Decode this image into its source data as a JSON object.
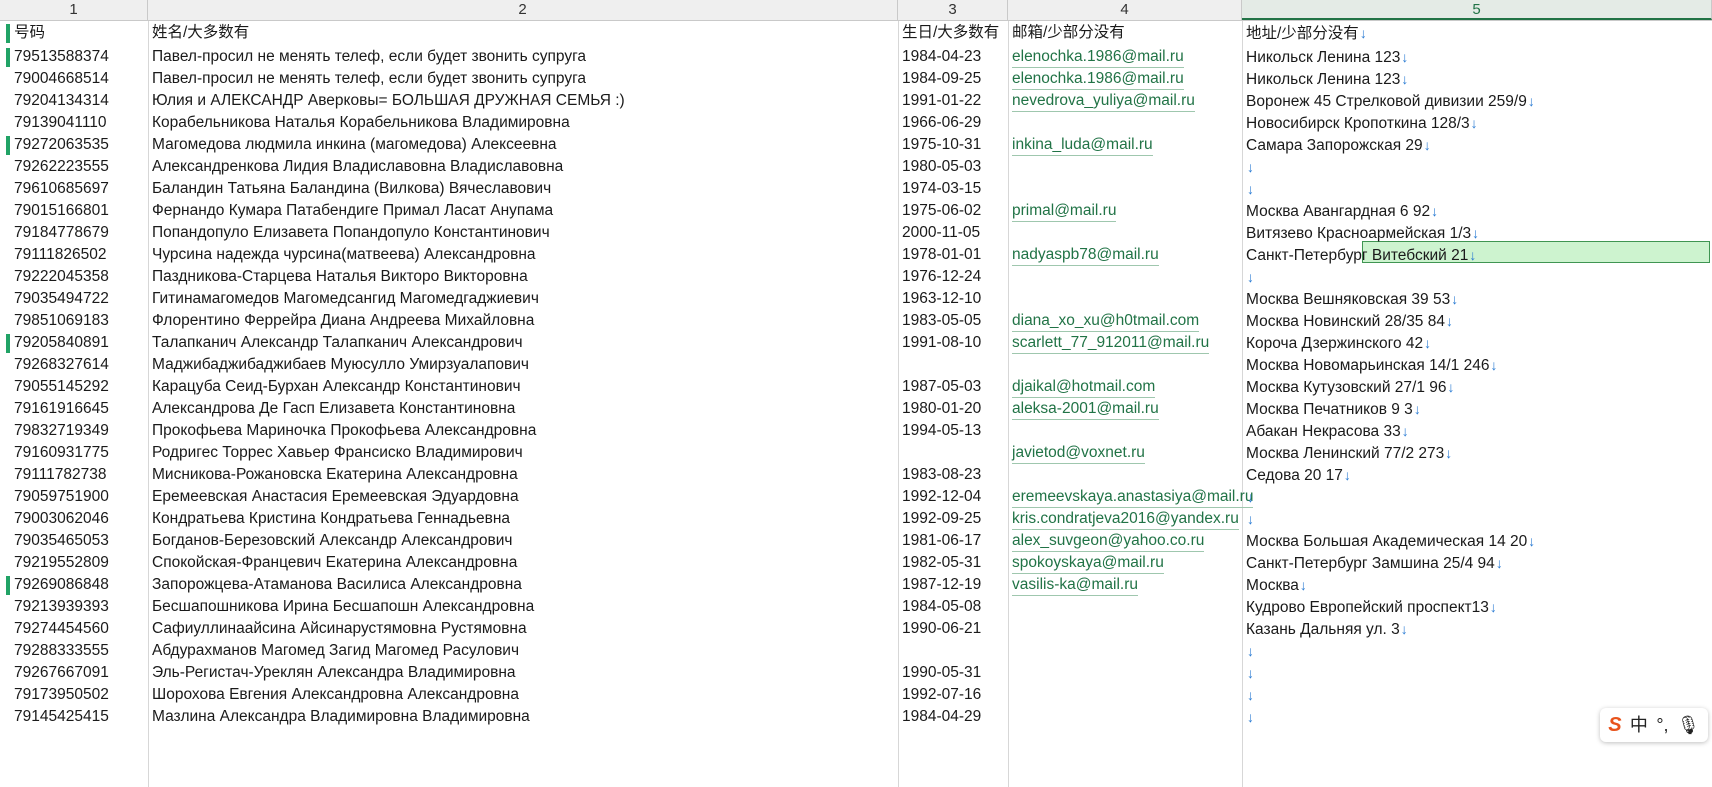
{
  "columns": [
    "1",
    "2",
    "3",
    "4",
    "5"
  ],
  "active_column": 4,
  "header_row": {
    "c1": "号码",
    "c2": "姓名/大多数有",
    "c3": "生日/大多数有",
    "c4": "邮箱/少部分没有",
    "c5": "地址/少部分没有"
  },
  "rows": [
    {
      "phone": "79513588374",
      "name": "Павел-просил не менять телеф, если будет звонить супруга",
      "birthday": "1984-04-23",
      "email": "elenochka.1986@mail.ru",
      "address": "Никольск Ленина 123"
    },
    {
      "phone": "79004668514",
      "name": "Павел-просил не менять телеф, если будет звонить супруга",
      "birthday": "1984-09-25",
      "email": "elenochka.1986@mail.ru",
      "address": "Никольск Ленина 123"
    },
    {
      "phone": "79204134314",
      "name": "Юлия и АЛЕКСАНДР Аверковы= БОЛЬШАЯ ДРУЖНАЯ СЕМЬЯ :)",
      "birthday": "1991-01-22",
      "email": "nevedrova_yuliya@mail.ru",
      "address": "Воронеж 45 Стрелковой дивизии 259/9"
    },
    {
      "phone": "79139041110",
      "name": "Корабельникова Наталья Корабельникова Владимировна",
      "birthday": "1966-06-29",
      "email": "",
      "address": "Новосибирск Кропоткина 128/3"
    },
    {
      "phone": "79272063535",
      "name": "Магомедова людмила инкина (магомедова) Алексеевна",
      "birthday": "1975-10-31",
      "email": "inkina_luda@mail.ru",
      "address": "Самара Запорожская 29"
    },
    {
      "phone": "79262223555",
      "name": "Александренкова Лидия Владиславовна Владиславовна",
      "birthday": "1980-05-03",
      "email": "",
      "address": ""
    },
    {
      "phone": "79610685697",
      "name": "Баландин Татьяна Баландина (Вилкова) Вячеславович",
      "birthday": "1974-03-15",
      "email": "",
      "address": ""
    },
    {
      "phone": "79015166801",
      "name": "Фернандо Кумара Патабендиге Примал Ласат Анупама",
      "birthday": "1975-06-02",
      "email": "primal@mail.ru",
      "address": "Москва Авангардная 6 92"
    },
    {
      "phone": "79184778679",
      "name": "Попандопуло Елизавета Попандопуло Константинович",
      "birthday": "2000-11-05",
      "email": "",
      "address": "Витязево Красноармейская 1/3"
    },
    {
      "phone": "79111826502",
      "name": "Чурсина надежда чурсина(матвеева) Александровна",
      "birthday": "1978-01-01",
      "email": "nadyaspb78@mail.ru",
      "address": "Санкт-Петербург Витебский 21"
    },
    {
      "phone": "79222045358",
      "name": "Паздникова-Старцева Наталья Викторо Викторовна",
      "birthday": "1976-12-24",
      "email": "",
      "address": ""
    },
    {
      "phone": "79035494722",
      "name": "Гитинамагомедов Магомедсангид Магомедгаджиевич",
      "birthday": "1963-12-10",
      "email": "",
      "address": "Москва Вешняковская 39 53"
    },
    {
      "phone": "79851069183",
      "name": "Флорентино Феррейра Диана Андреева Михайловна",
      "birthday": "1983-05-05",
      "email": "diana_xo_xu@h0tmail.com",
      "address": "Москва Новинский 28/35 84"
    },
    {
      "phone": "79205840891",
      "name": "Талапканич Александр Талапканич Александрович",
      "birthday": "1991-08-10",
      "email": "scarlett_77_912011@mail.ru",
      "address": "Короча Дзержинского 42"
    },
    {
      "phone": "79268327614",
      "name": "Маджибаджибаджибаев Муюсулло Умирзуалапович",
      "birthday": "",
      "email": "",
      "address": "Москва Новомарьинская 14/1 246"
    },
    {
      "phone": "79055145292",
      "name": "Карацуба Сеид-Бурхан Александр Константинович",
      "birthday": "1987-05-03",
      "email": "djaikal@hotmail.com",
      "address": "Москва Кутузовский 27/1 96"
    },
    {
      "phone": "79161916645",
      "name": "Александрова Де Гасп Елизавета Константиновна",
      "birthday": "1980-01-20",
      "email": "aleksa-2001@mail.ru",
      "address": "Москва Печатников 9 3"
    },
    {
      "phone": "79832719349",
      "name": "Прокофьева Мариночка Прокофьева Александровна",
      "birthday": "1994-05-13",
      "email": "",
      "address": "Абакан Некрасова 33"
    },
    {
      "phone": "79160931775",
      "name": "Родригес Торрес Хавьер Франсиско Владимирович",
      "birthday": "",
      "email": "javietod@voxnet.ru",
      "address": "Москва Ленинский 77/2 273"
    },
    {
      "phone": "79111782738",
      "name": "Мисникова-Рожановска Екатерина Александровна",
      "birthday": "1983-08-23",
      "email": "",
      "address": "Седова 20 17"
    },
    {
      "phone": "79059751900",
      "name": "Еремеевская Анастасия Еремеевская Эдуардовна",
      "birthday": "1992-12-04",
      "email": "eremeevskaya.anastasiya@mail.ru",
      "address": ""
    },
    {
      "phone": "79003062046",
      "name": "Кондратьева Кристина Кондратьева Геннадьевна",
      "birthday": "1992-09-25",
      "email": "kris.condratjeva2016@yandex.ru",
      "address": ""
    },
    {
      "phone": "79035465053",
      "name": "Богданов-Березовский Александр Александрович",
      "birthday": "1981-06-17",
      "email": "alex_suvgeon@yahoo.co.ru",
      "address": "Москва Большая Академическая 14 20"
    },
    {
      "phone": "79219552809",
      "name": "Спокойская-Францевич Екатерина Александровна",
      "birthday": "1982-05-31",
      "email": "spokoyskaya@mail.ru",
      "address": "Санкт-Петербург Замшина 25/4 94"
    },
    {
      "phone": "79269086848",
      "name": "Запорожцева-Атаманова Василиса Александровна",
      "birthday": "1987-12-19",
      "email": "vasilis-ka@mail.ru",
      "address": "Москва"
    },
    {
      "phone": "79213939393",
      "name": "Бесшапошникова Ирина Бесшапошн Александровна",
      "birthday": "1984-05-08",
      "email": "",
      "address": "Кудрово Европейский проспект13"
    },
    {
      "phone": "79274454560",
      "name": "Сафиуллинаайсина Айсинарустямовна Рустямовна",
      "birthday": "1990-06-21",
      "email": "",
      "address": "Казань Дальняя ул. 3"
    },
    {
      "phone": "79288333555",
      "name": "Абдурахманов Магомед Загид Магомед Расулович",
      "birthday": "",
      "email": "",
      "address": ""
    },
    {
      "phone": "79267667091",
      "name": "Эль-Регистач-Уреклян Александра Владимировна",
      "birthday": "1990-05-31",
      "email": "",
      "address": ""
    },
    {
      "phone": "79173950502",
      "name": "Шорохова Евгения Александровна Александровна",
      "birthday": "1992-07-16",
      "email": "",
      "address": ""
    },
    {
      "phone": "79145425415",
      "name": "Мазлина Александра Владимировна Владимировна",
      "birthday": "1984-04-29",
      "email": "",
      "address": ""
    }
  ],
  "marked_rows": [
    0,
    4,
    13,
    24
  ],
  "selected_row": 9,
  "eol_glyph": "↓",
  "ime": {
    "logo": "S",
    "lang": "中",
    "punct": "°,",
    "mic": "🎙"
  },
  "colors": {
    "email_text": "#217346",
    "selection_fill": "#cdf3cf",
    "marker": "#21a366",
    "eol_arrow": "#2b7cd3"
  }
}
